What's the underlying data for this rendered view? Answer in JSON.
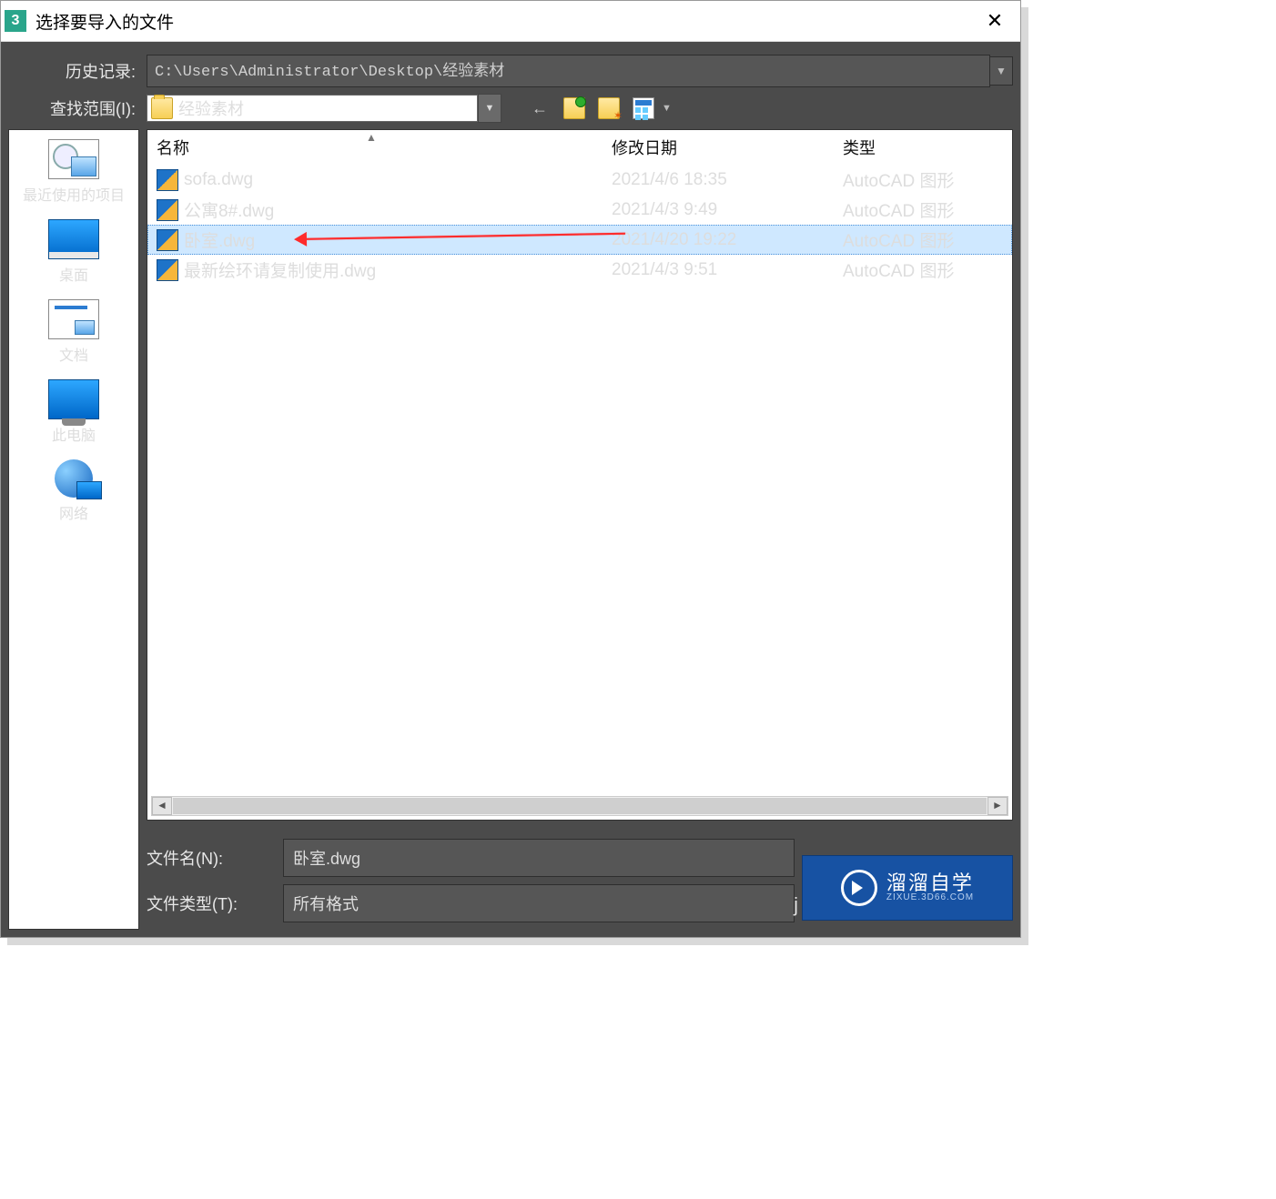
{
  "window": {
    "title": "选择要导入的文件",
    "app_badge": "3"
  },
  "history": {
    "label": "历史记录:",
    "value": "C:\\Users\\Administrator\\Desktop\\经验素材"
  },
  "lookin": {
    "label": "查找范围(I):",
    "value": "经验素材"
  },
  "toolbar": {
    "back": "←",
    "up": "up-folder",
    "new": "new-folder",
    "view": "views"
  },
  "places": {
    "recent": "最近使用的项目",
    "desktop": "桌面",
    "documents": "文档",
    "thispc": "此电脑",
    "network": "网络"
  },
  "columns": {
    "name": "名称",
    "date": "修改日期",
    "type": "类型"
  },
  "files": [
    {
      "name": "sofa.dwg",
      "date": "2021/4/6 18:35",
      "type": "AutoCAD 图形",
      "selected": false
    },
    {
      "name": "公寓8#.dwg",
      "date": "2021/4/3 9:49",
      "type": "AutoCAD 图形",
      "selected": false
    },
    {
      "name": "卧室.dwg",
      "date": "2021/4/20 19:22",
      "type": "AutoCAD 图形",
      "selected": true
    },
    {
      "name": "最新绘环请复制使用.dwg",
      "date": "2021/4/3 9:51",
      "type": "AutoCAD 图形",
      "selected": false
    }
  ],
  "footer": {
    "filename_label": "文件名(N):",
    "filename_value": "卧室.dwg",
    "filetype_label": "文件类型(T):",
    "filetype_value": "所有格式"
  },
  "watermark": {
    "text": "溜溜自学",
    "sub": "ZIXUE.3D66.COM",
    "side": "j"
  }
}
